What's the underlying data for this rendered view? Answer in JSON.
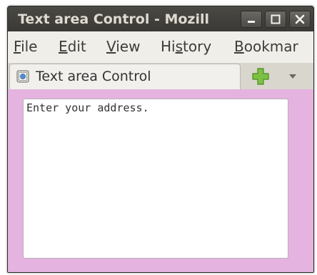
{
  "window": {
    "title": "Text area Control - Mozill",
    "minimize_label": "−",
    "maximize_label": "□",
    "close_label": "×"
  },
  "menubar": {
    "items": [
      {
        "mnemonic": "F",
        "rest": "ile"
      },
      {
        "mnemonic": "E",
        "rest": "dit"
      },
      {
        "mnemonic": "V",
        "rest": "iew"
      },
      {
        "pre": "Hi",
        "mnemonic": "s",
        "rest": "tory"
      },
      {
        "mnemonic": "B",
        "rest": "ookmar"
      }
    ]
  },
  "tabbar": {
    "tab_label": "Text area Control",
    "new_tab_icon": "plus-icon",
    "tab_list_icon": "chevron-down-icon"
  },
  "content": {
    "background_color": "#e4b3e0",
    "textarea_value": "Enter your address."
  }
}
